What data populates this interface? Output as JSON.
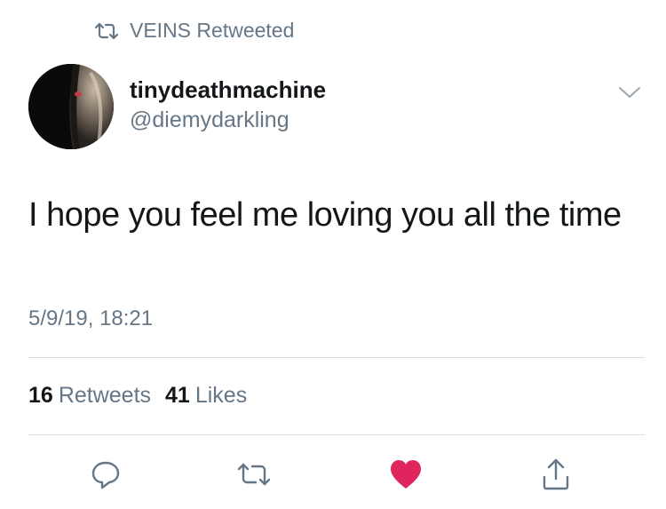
{
  "retweet_context": {
    "text": "VEINS Retweeted",
    "icon": "retweet-icon"
  },
  "author": {
    "display_name": "tinydeathmachine",
    "handle": "@diemydarkling"
  },
  "tweet": {
    "text": "I hope you feel me loving you all the time",
    "timestamp": "5/9/19, 18:21"
  },
  "stats": {
    "retweets_count": "16",
    "retweets_label": "Retweets",
    "likes_count": "41",
    "likes_label": "Likes"
  },
  "actions": [
    {
      "name": "reply",
      "icon": "reply-icon"
    },
    {
      "name": "retweet",
      "icon": "retweet-icon"
    },
    {
      "name": "like",
      "icon": "heart-icon",
      "active": true
    },
    {
      "name": "share",
      "icon": "share-icon"
    }
  ],
  "colors": {
    "primary_text": "#14171a",
    "secondary_text": "#657786",
    "divider": "#d8dde2",
    "like_active": "#e0245e"
  }
}
